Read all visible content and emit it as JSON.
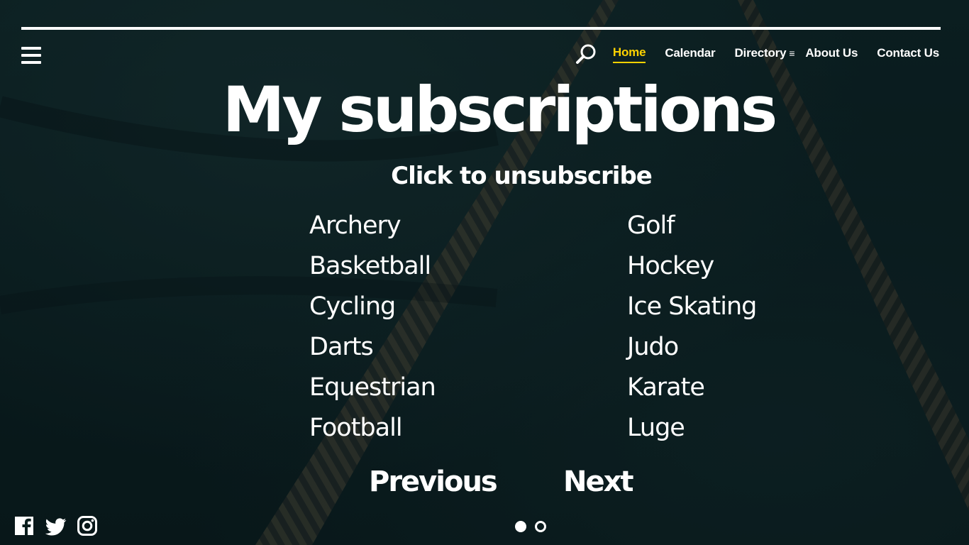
{
  "nav": {
    "items": [
      {
        "label": "Home",
        "active": true
      },
      {
        "label": "Calendar",
        "active": false
      },
      {
        "label": "Directory",
        "active": false
      },
      {
        "label": "About Us",
        "active": false
      },
      {
        "label": "Contact Us",
        "active": false
      }
    ],
    "directory_icon": "≡",
    "accent_color": "#ffd200"
  },
  "page": {
    "title": "My subscriptions",
    "subtitle": "Click to unsubscribe"
  },
  "subscriptions": {
    "left": [
      "Archery",
      "Basketball",
      "Cycling",
      "Darts",
      "Equestrian",
      "Football"
    ],
    "right": [
      "Golf",
      "Hockey",
      "Ice Skating",
      "Judo",
      "Karate",
      "Luge"
    ]
  },
  "pagination": {
    "previous_label": "Previous",
    "next_label": "Next",
    "current_page": 1,
    "total_pages": 2
  },
  "social": {
    "icons": [
      "facebook-icon",
      "twitter-icon",
      "instagram-icon"
    ]
  },
  "icons": {
    "menu": "hamburger-menu-icon",
    "search": "search-icon"
  }
}
